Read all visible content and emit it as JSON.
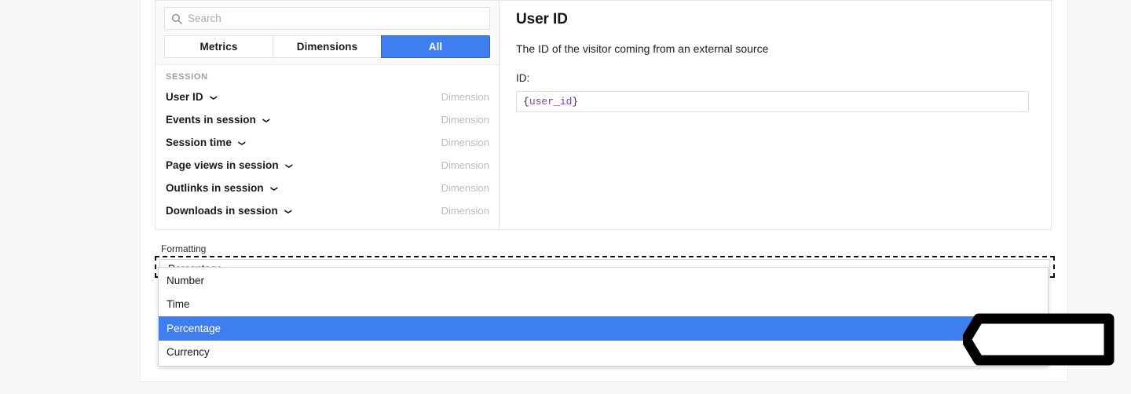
{
  "search": {
    "placeholder": "Search",
    "value": "",
    "icon": "search-icon"
  },
  "segmented": {
    "options": [
      {
        "label": "Metrics",
        "active": false
      },
      {
        "label": "Dimensions",
        "active": false
      },
      {
        "label": "All",
        "active": true
      }
    ],
    "active_color": "#3d7ef0"
  },
  "list": {
    "group_title": "SESSION",
    "rows": [
      {
        "label": "User ID",
        "kind": "Dimension",
        "caret": "chevron-down-icon"
      },
      {
        "label": "Events in session",
        "kind": "Dimension",
        "caret": "chevron-down-icon"
      },
      {
        "label": "Session time",
        "kind": "Dimension",
        "caret": "chevron-down-icon"
      },
      {
        "label": "Page views in session",
        "kind": "Dimension",
        "caret": "chevron-down-icon"
      },
      {
        "label": "Outlinks in session",
        "kind": "Dimension",
        "caret": "chevron-down-icon"
      },
      {
        "label": "Downloads in session",
        "kind": "Dimension",
        "caret": "chevron-down-icon"
      }
    ]
  },
  "detail": {
    "title": "User ID",
    "description": "The ID of the visitor coming from an external source",
    "field_label": "ID:",
    "value_open_brace": "{",
    "value_variable": "user_id",
    "value_close_brace": "}",
    "value_full": "{user_id}",
    "variable_color": "#7b3ec0"
  },
  "formatting": {
    "label": "Formatting",
    "selected": "Percentage",
    "chevron": "chevron-down-icon",
    "options": [
      {
        "label": "Number",
        "selected": false
      },
      {
        "label": "Time",
        "selected": false
      },
      {
        "label": "Percentage",
        "selected": true
      },
      {
        "label": "Currency",
        "selected": false
      }
    ],
    "highlight_color": "#3d7ef0"
  },
  "annotation": {
    "type": "arrow-left",
    "color": "#000000",
    "points_at": "Percentage"
  }
}
